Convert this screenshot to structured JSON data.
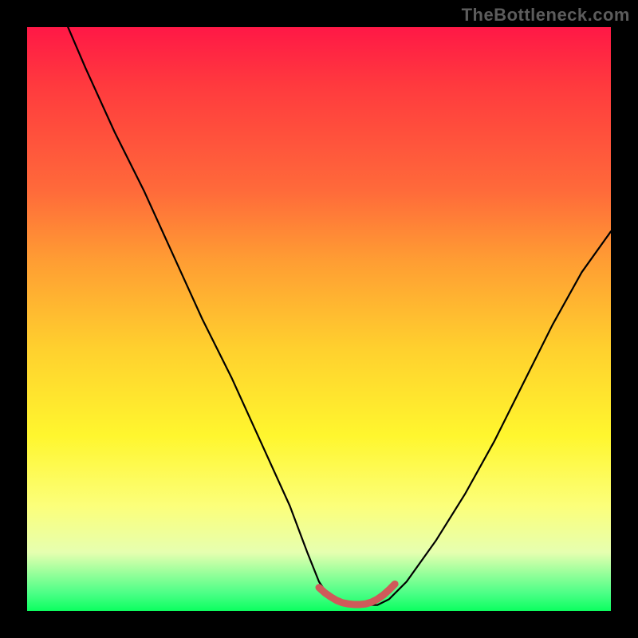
{
  "watermark": "TheBottleneck.com",
  "chart_data": {
    "type": "line",
    "title": "",
    "xlabel": "",
    "ylabel": "",
    "xlim": [
      0,
      100
    ],
    "ylim": [
      0,
      100
    ],
    "series": [
      {
        "name": "black-curve",
        "color": "#000000",
        "width": 2.2,
        "x": [
          7,
          10,
          15,
          20,
          25,
          30,
          35,
          40,
          45,
          48,
          50,
          52,
          55,
          58,
          60,
          62,
          65,
          70,
          75,
          80,
          85,
          90,
          95,
          100
        ],
        "y": [
          100,
          93,
          82,
          72,
          61,
          50,
          40,
          29,
          18,
          10,
          5,
          2,
          1,
          1,
          1,
          2,
          5,
          12,
          20,
          29,
          39,
          49,
          58,
          65
        ]
      },
      {
        "name": "pink-segment",
        "color": "#cf5a5a",
        "width": 9,
        "x": [
          50,
          51,
          52,
          53,
          54,
          55,
          56,
          57,
          58,
          59,
          60,
          61,
          62,
          63
        ],
        "y": [
          4,
          3.1,
          2.4,
          1.8,
          1.4,
          1.2,
          1.1,
          1.1,
          1.2,
          1.5,
          2.0,
          2.7,
          3.6,
          4.6
        ]
      }
    ],
    "gradient_background": {
      "orientation": "vertical",
      "stops": [
        {
          "pos": 0.0,
          "color": "#ff1846"
        },
        {
          "pos": 0.1,
          "color": "#ff3a3e"
        },
        {
          "pos": 0.28,
          "color": "#ff6a3a"
        },
        {
          "pos": 0.4,
          "color": "#ff9d33"
        },
        {
          "pos": 0.55,
          "color": "#ffd02e"
        },
        {
          "pos": 0.7,
          "color": "#fff62e"
        },
        {
          "pos": 0.82,
          "color": "#fcff7a"
        },
        {
          "pos": 0.9,
          "color": "#e6ffb0"
        },
        {
          "pos": 0.97,
          "color": "#4bff86"
        },
        {
          "pos": 1.0,
          "color": "#0cff60"
        }
      ]
    }
  },
  "colors": {
    "frame": "#000000",
    "watermark": "#5c5c5c"
  }
}
